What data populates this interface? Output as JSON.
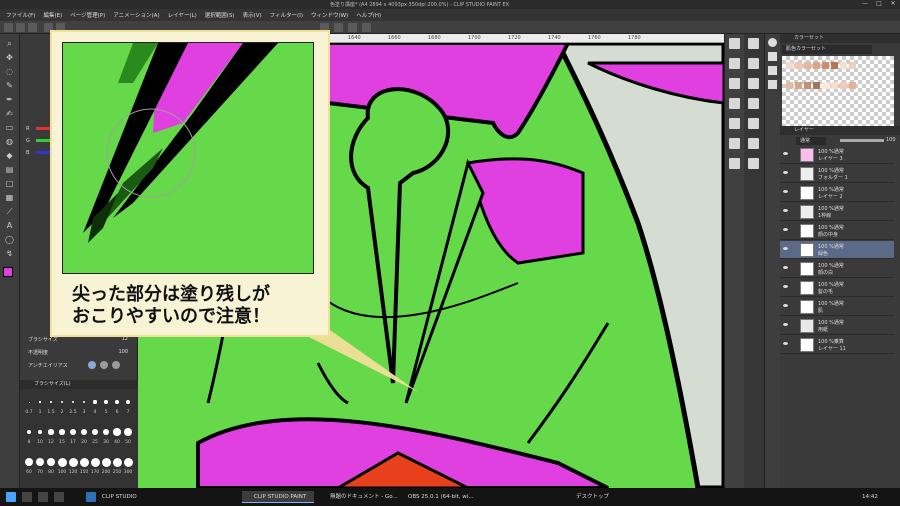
{
  "window": {
    "title": "色塗り講座* (A4 2894 x 4093px 350dpi 200.0%) - CLIP STUDIO PAINT EX",
    "controls": [
      "—",
      "□",
      "✕"
    ]
  },
  "menu": {
    "items": [
      "ファイル(F)",
      "編集(E)",
      "ページ管理(P)",
      "アニメーション(A)",
      "レイヤー(L)",
      "選択範囲(S)",
      "表示(V)",
      "フィルター(I)",
      "ウィンドウ(W)",
      "ヘルプ(H)"
    ]
  },
  "ruler": {
    "ticks": [
      "1640",
      "1660",
      "1680",
      "1700",
      "1720",
      "1740",
      "1760",
      "1780"
    ]
  },
  "subtool": {
    "color_rows": [
      "R",
      "G",
      "B"
    ],
    "brush_size_label": "ブラシサイズ",
    "brush_size_value": "12",
    "hardness_label": "不透明度",
    "hardness_value": "100",
    "antialias_label": "アンチエイリアス",
    "size_panel_title": "ブラシサイズ(L)",
    "sizes": [
      "0.7",
      "1",
      "1.5",
      "2",
      "2.5",
      "3",
      "4",
      "5",
      "6",
      "7",
      "8",
      "10",
      "12",
      "15",
      "17",
      "20",
      "25",
      "30",
      "40",
      "50",
      "60",
      "70",
      "80",
      "100",
      "120",
      "150",
      "170",
      "200",
      "250",
      "300"
    ]
  },
  "color_set": {
    "title": "カラーセット",
    "set_name": "肌色カラーセット"
  },
  "layers": {
    "title": "レイヤー",
    "blend_mode": "通常",
    "opacity": "100",
    "items": [
      {
        "mode": "100 %通常",
        "name": "レイヤー 3",
        "selected": false
      },
      {
        "mode": "100 %通常",
        "name": "フォルダー 1",
        "selected": false
      },
      {
        "mode": "100 %通常",
        "name": "レイヤー 2",
        "selected": false
      },
      {
        "mode": "100 %通常",
        "name": "1枠線",
        "selected": false
      },
      {
        "mode": "100 %通常",
        "name": "顔の中身",
        "selected": false
      },
      {
        "mode": "100 %通常",
        "name": "緑色",
        "selected": true
      },
      {
        "mode": "100 %通常",
        "name": "顔の白",
        "selected": false
      },
      {
        "mode": "100 %通常",
        "name": "髪の毛",
        "selected": false
      },
      {
        "mode": "100 %通常",
        "name": "肌",
        "selected": false
      },
      {
        "mode": "100 %通常",
        "name": "用紙",
        "selected": false
      },
      {
        "mode": "100 %乗算",
        "name": "レイヤー 11",
        "selected": false
      }
    ]
  },
  "callout": {
    "text": "尖った部分は塗り残しが\nおこりやすいので注意！"
  },
  "taskbar": {
    "items": [
      "CLIP STUDIO",
      "CLIP STUDIO PAINT",
      "無題のドキュメント - Go...",
      "OBS 25.0.1 (64-bit, wi..."
    ],
    "tray_label": "デスクトップ",
    "clock": "14:42"
  },
  "colors": {
    "fill_green": "#66d94a",
    "fill_magenta": "#e040e0",
    "background_gray": "#d5ddd2",
    "outline": "#000000",
    "accent_orange": "#e8401c",
    "callout_bg": "#f7f3d4",
    "callout_border": "#f2df9a"
  }
}
